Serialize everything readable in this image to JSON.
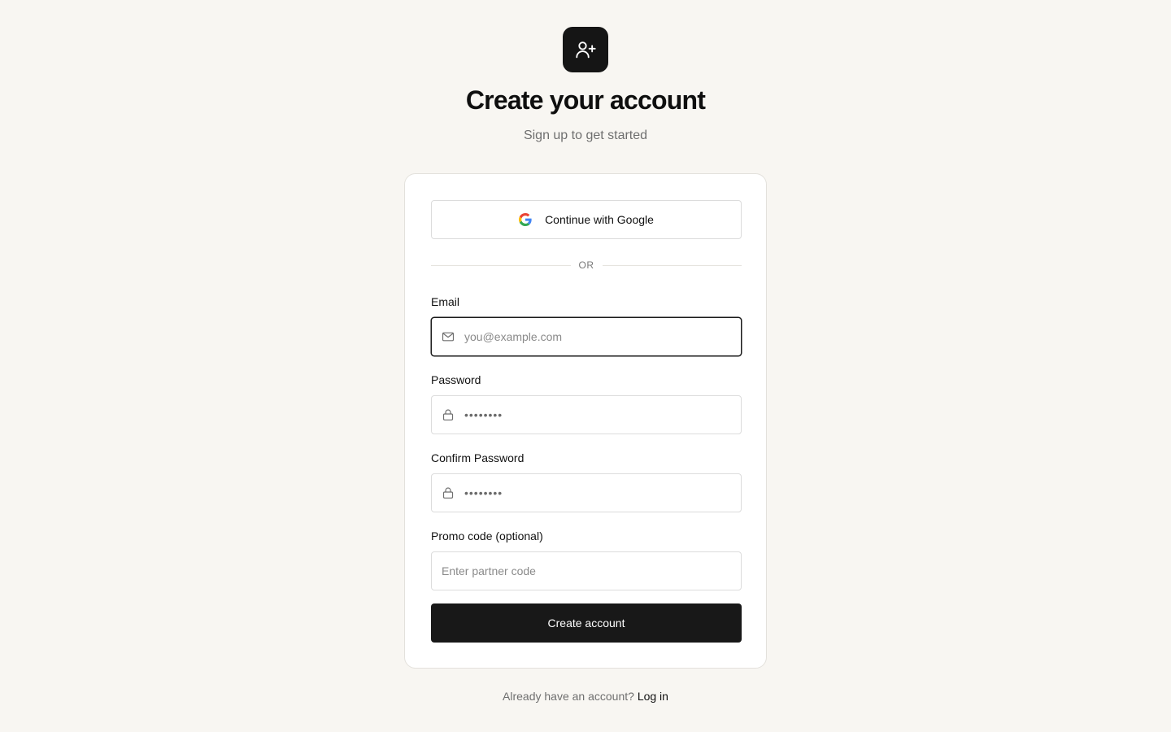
{
  "header": {
    "logo_icon": "user-plus-icon",
    "title": "Create your account",
    "subtitle": "Sign up to get started"
  },
  "google_button": {
    "label": "Continue with Google",
    "icon": "google-icon"
  },
  "divider": {
    "label": "OR"
  },
  "email": {
    "label": "Email",
    "placeholder": "you@example.com",
    "icon": "mail-icon"
  },
  "password": {
    "label": "Password",
    "value_masked": "••••••••",
    "icon": "lock-icon"
  },
  "confirm_password": {
    "label": "Confirm Password",
    "value_masked": "••••••••",
    "icon": "lock-icon"
  },
  "promo": {
    "label": "Promo code (optional)",
    "placeholder": "Enter partner code"
  },
  "submit": {
    "label": "Create account"
  },
  "footer": {
    "prompt": "Already have an account?",
    "link": "Log in"
  },
  "colors": {
    "background": "#f8f6f2",
    "primary": "#181818",
    "border": "#dcdcdc",
    "muted_text": "#6f6f6f"
  }
}
